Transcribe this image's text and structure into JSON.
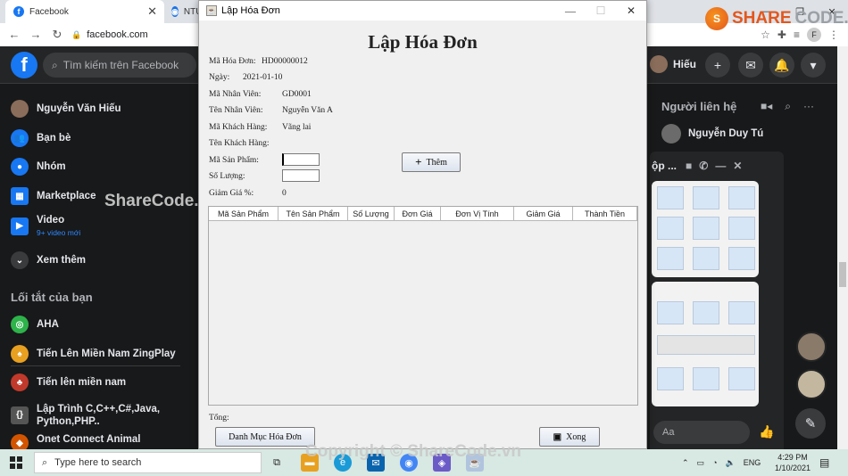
{
  "chrome": {
    "tabs": [
      {
        "label": "Facebook",
        "favicon": "facebook-favicon"
      },
      {
        "label": "NTU",
        "favicon": "ntu-favicon"
      }
    ],
    "url": "facebook.com",
    "profile_initial": "F"
  },
  "watermark": {
    "logo_share": "SHARE",
    "logo_code": "CODE.vn",
    "left": "ShareCode.vn",
    "bottom": "Copyright © ShareCode.vn"
  },
  "facebook": {
    "search_placeholder": "Tìm kiếm trên Facebook",
    "user_name": "Hiếu",
    "left_items": [
      {
        "label": "Nguyễn Văn Hiếu",
        "icon": "user-avatar",
        "color": "#8a6d5a"
      },
      {
        "label": "Bạn bè",
        "icon": "friends-icon",
        "color": "#1877f2"
      },
      {
        "label": "Nhóm",
        "icon": "groups-icon",
        "color": "#1877f2"
      },
      {
        "label": "Marketplace",
        "icon": "marketplace-icon",
        "color": "#1877f2"
      },
      {
        "label": "Video",
        "sub": "9+ video mới",
        "icon": "video-icon",
        "color": "#1877f2"
      },
      {
        "label": "Xem thêm",
        "icon": "chevron-down-icon",
        "color": "#3a3b3c"
      }
    ],
    "shortcuts_title": "Lối tắt của bạn",
    "shortcuts": [
      {
        "label": "AHA",
        "icon": "aha-icon",
        "color": "#2db34a"
      },
      {
        "label": "Tiến Lên Miền Nam ZingPlay",
        "icon": "zingplay-icon",
        "color": "#e8a020"
      },
      {
        "label": "Tiến lên miền nam",
        "icon": "card-game-icon",
        "color": "#c0392b"
      },
      {
        "label": "Lập Trình C,C++,C#,Java,",
        "label2": "Python,PHP..",
        "icon": "programming-icon",
        "color": "#555555"
      },
      {
        "label": "Onet Connect Animal",
        "icon": "onet-icon",
        "color": "#d35400"
      }
    ],
    "contacts_title": "Người liên hệ",
    "contact_name": "Nguyễn Duy Tú",
    "chat_title": "ộp ...",
    "chat_placeholder": "Aa"
  },
  "dialog": {
    "window_title": "Lập Hóa Đơn",
    "heading": "Lập Hóa Đơn",
    "fields": {
      "ma_hoa_don": {
        "label": "Mã Hóa Đơn:",
        "value": "HD00000012"
      },
      "ngay": {
        "label": "Ngày:",
        "value": "2021-01-10"
      },
      "ma_nhan_vien": {
        "label": "Mã Nhân Viên:",
        "value": "GD0001"
      },
      "ten_nhan_vien": {
        "label": "Tên Nhân Viên:",
        "value": "Nguyễn Văn A"
      },
      "ma_khach_hang": {
        "label": "Mã Khách Hàng:",
        "value": "Vãng lai"
      },
      "ten_khach_hang": {
        "label": "Tên Khách Hàng:",
        "value": ""
      },
      "ma_san_pham": {
        "label": "Mã Sản Phẩm:",
        "value": ""
      },
      "so_luong": {
        "label": "Số Lượng:",
        "value": ""
      },
      "giam_gia": {
        "label": "Giảm Giá %:",
        "value": "0"
      }
    },
    "add_button": "Thêm",
    "table_columns": [
      "Mã Sản Phẩm",
      "Tên Sản Phẩm",
      "Số Lượng",
      "Đơn Giá",
      "Đơn Vị Tính",
      "Giảm Giá",
      "Thành Tiền"
    ],
    "table_rows": [],
    "total_label": "Tổng:",
    "list_button": "Danh Mục Hóa Đơn",
    "done_button": "Xong"
  },
  "taskbar": {
    "search_placeholder": "Type here to search",
    "language": "ENG",
    "time": "4:29 PM",
    "date": "1/10/2021"
  }
}
